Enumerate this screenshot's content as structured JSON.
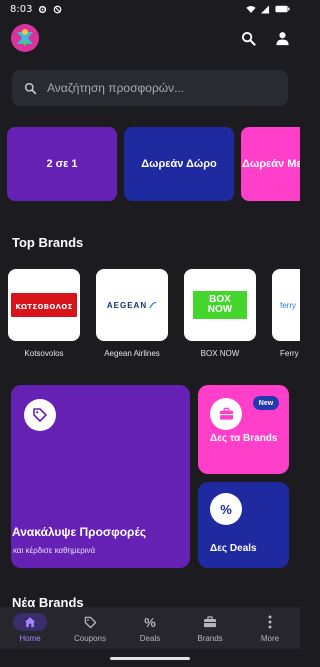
{
  "status_bar": {
    "time": "8:03",
    "icons": [
      "settings-icon",
      "block-icon",
      "wifi-icon",
      "signal-icon",
      "battery-icon"
    ]
  },
  "header": {
    "logo": "app-logo",
    "icons": [
      "search-icon",
      "account-icon"
    ]
  },
  "search": {
    "placeholder": "Αναζήτηση προσφορών...",
    "icon": "search-icon"
  },
  "promos": [
    {
      "label": "2 σε 1",
      "color": "#6521b4"
    },
    {
      "label": "Δωρεάν Δώρο",
      "color": "#1f2aa0"
    },
    {
      "label": "Δωρεάν Μεταφορικά",
      "color": "#ff3fc9"
    }
  ],
  "top_brands": {
    "title": "Top Brands",
    "items": [
      {
        "name": "Kotsovolos",
        "logo_text": "ΚΩΤΣΟΒΟΛΟΣ"
      },
      {
        "name": "Aegean Airlines",
        "logo_text": "AEGEAN"
      },
      {
        "name": "BOX NOW",
        "logo_text": "BOX NOW"
      },
      {
        "name": "Ferry",
        "logo_text": "ferry"
      }
    ]
  },
  "feature_cards": {
    "discover": {
      "title": "Ανακάλυψε Προσφορές",
      "subtitle": "και κέρδισε καθημερινά",
      "icon": "tag-icon"
    },
    "see_brands": {
      "label": "Δες τα Brands",
      "badge": "New",
      "icon": "briefcase-icon"
    },
    "see_deals": {
      "label": "Δες Deals",
      "icon": "percent-icon"
    }
  },
  "new_brands": {
    "title": "Νέα Brands"
  },
  "bottom_nav": [
    {
      "label": "Home",
      "icon": "home-icon",
      "active": true
    },
    {
      "label": "Coupons",
      "icon": "coupon-icon",
      "active": false
    },
    {
      "label": "Deals",
      "icon": "percent-icon",
      "active": false
    },
    {
      "label": "Brands",
      "icon": "briefcase-icon",
      "active": false
    },
    {
      "label": "More",
      "icon": "more-vertical-icon",
      "active": false
    }
  ],
  "colors": {
    "background": "#1b1b20",
    "accent": "#a685ff",
    "purple": "#6521b4",
    "blue": "#1f2aa0",
    "pink": "#ff3fc9"
  }
}
